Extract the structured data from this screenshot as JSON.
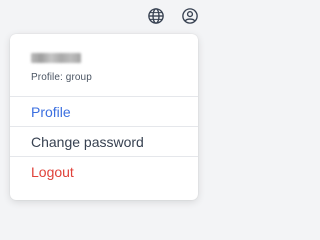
{
  "header": {
    "icons": [
      {
        "name": "globe-icon"
      },
      {
        "name": "user-icon"
      }
    ]
  },
  "menu": {
    "username_redacted": true,
    "role_text": "Profile: group",
    "items": [
      {
        "label": "Profile",
        "color": "#3b6fe0"
      },
      {
        "label": "Change password",
        "color": "#374151"
      },
      {
        "label": "Logout",
        "color": "#e0423a"
      }
    ]
  }
}
